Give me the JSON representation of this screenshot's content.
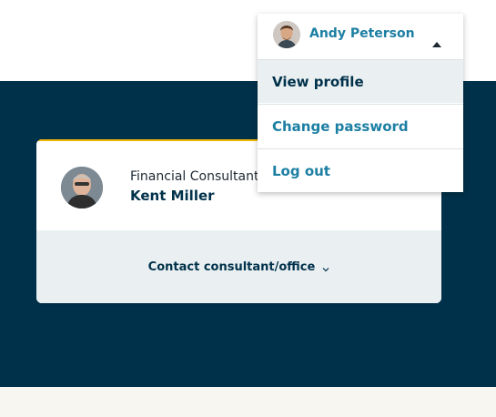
{
  "user_menu": {
    "user_name": "Andy Peterson",
    "avatar_icon": "user-avatar-icon",
    "items": [
      {
        "label": "View profile",
        "active": true
      },
      {
        "label": "Change password",
        "active": false
      },
      {
        "label": "Log out",
        "active": false
      }
    ]
  },
  "consultant": {
    "title": "Financial Consultant",
    "name": "Kent Miller",
    "contact_label": "Contact consultant/office"
  },
  "colors": {
    "navy": "#00314a",
    "link": "#1c7fa3",
    "accent": "#f2b705",
    "card_bottom": "#eaf0f2",
    "footer": "#f7f6f0"
  }
}
